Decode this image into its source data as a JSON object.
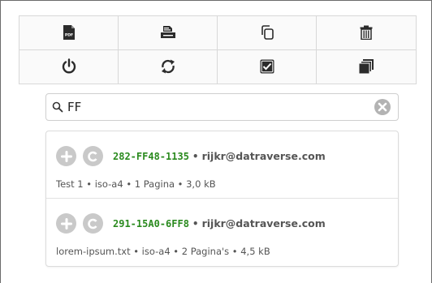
{
  "toolbar": {
    "buttons": [
      {
        "icon": "pdf-file-icon",
        "label": "PDF"
      },
      {
        "icon": "printer-icon"
      },
      {
        "icon": "copy-icon"
      },
      {
        "icon": "trash-icon"
      },
      {
        "icon": "power-icon"
      },
      {
        "icon": "refresh-icon"
      },
      {
        "icon": "checkbox-icon"
      },
      {
        "icon": "stack-icon"
      }
    ]
  },
  "search": {
    "value": "FF",
    "icon": "search-icon",
    "clear_icon": "clear-icon"
  },
  "results": [
    {
      "code": "282-FF48-1135",
      "separator": "•",
      "email": "rijkr@datraverse.com",
      "details": "Test 1 • iso-a4 • 1 Pagina • 3,0 kB"
    },
    {
      "code": "291-15A0-6FF8",
      "separator": "•",
      "email": "rijkr@datraverse.com",
      "details": "lorem-ipsum.txt • iso-a4 • 2 Pagina's • 4,5 kB"
    }
  ],
  "colors": {
    "code": "#2a8a1e",
    "icon": "#2b2b2b",
    "circle_button": "#c9c9c9"
  }
}
